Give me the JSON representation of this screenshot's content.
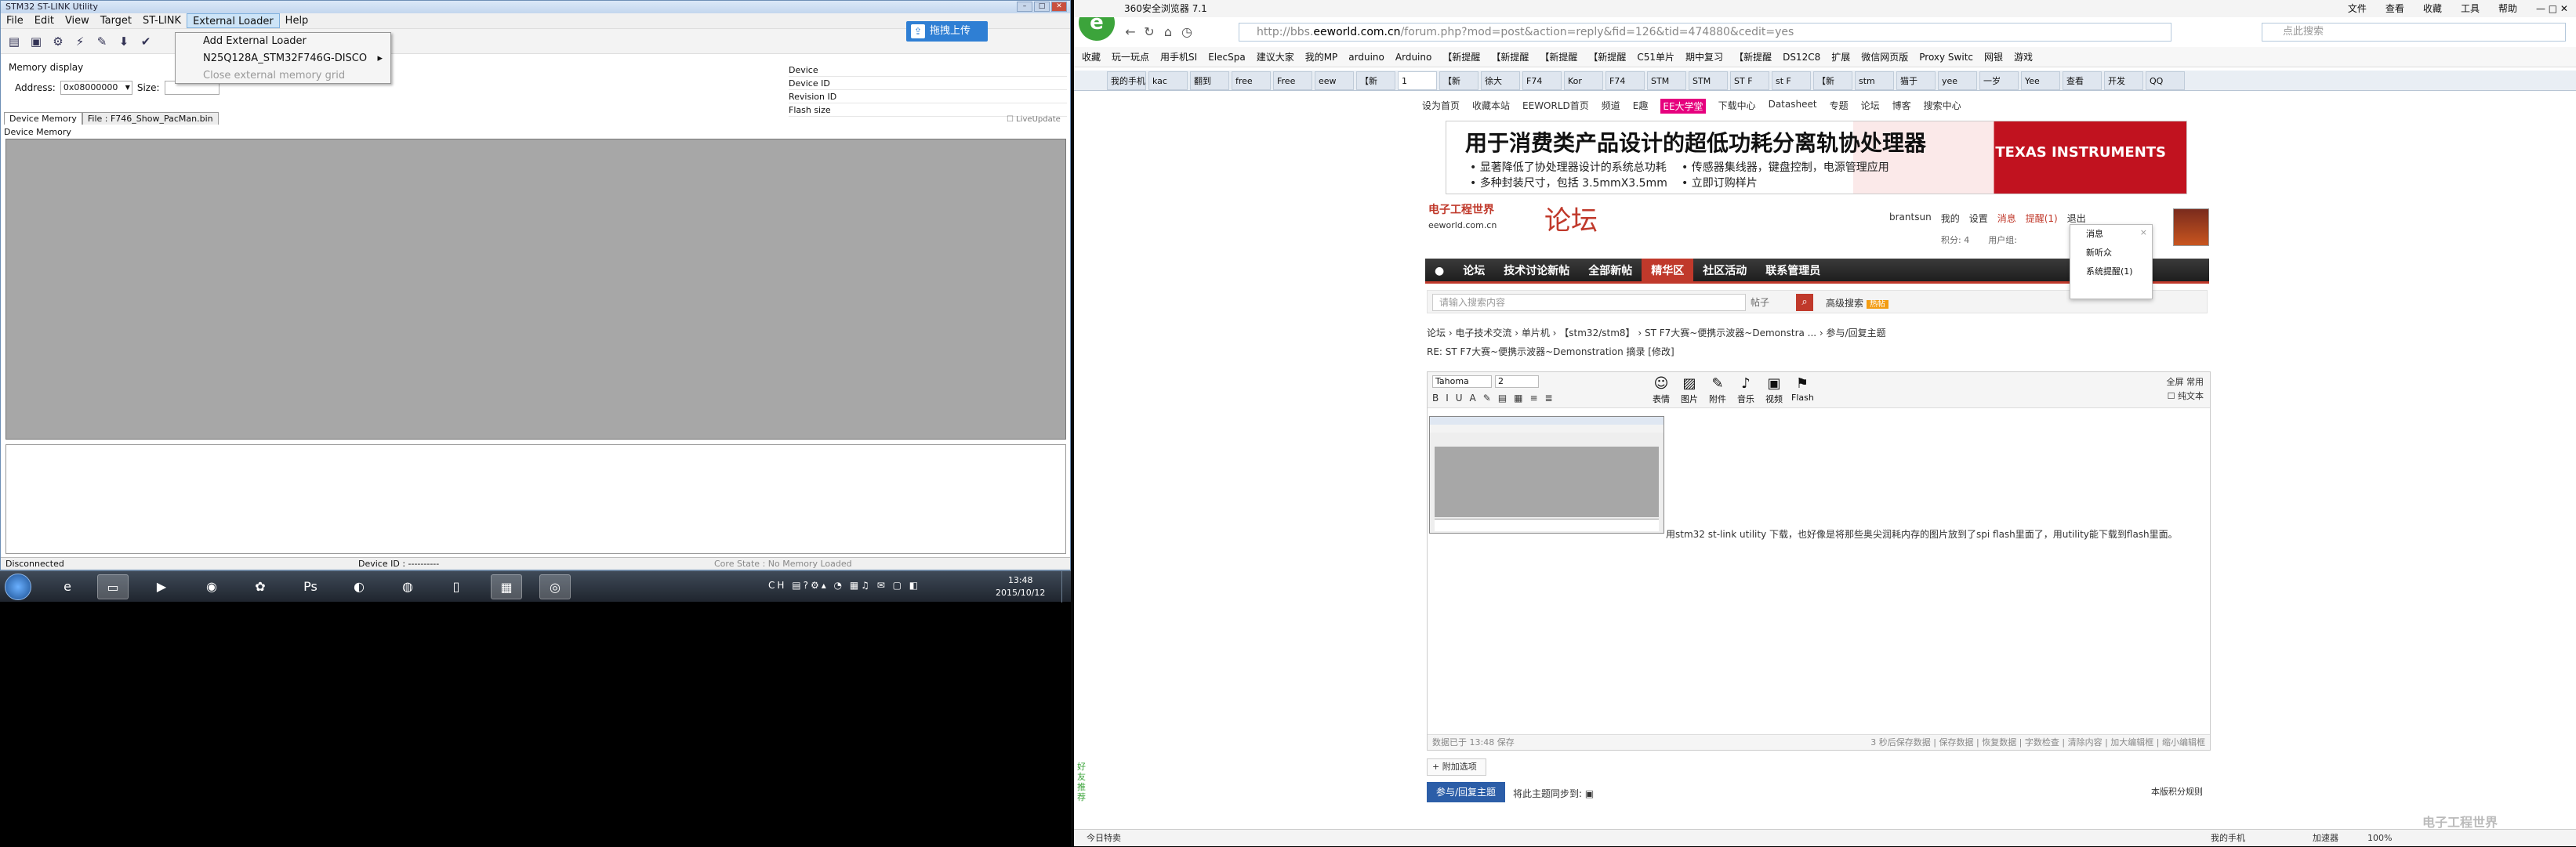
{
  "stlink": {
    "title": "STM32 ST-LINK Utility",
    "menu": [
      "File",
      "Edit",
      "View",
      "Target",
      "ST-LINK",
      "External Loader",
      "Help"
    ],
    "connect_label": "拖拽上传",
    "dropdown": {
      "item1": "Add External Loader",
      "item2": "N25Q128A_STM32F746G-DISCO",
      "item3": "Close external memory grid"
    },
    "memory_display_label": "Memory display",
    "address_label": "Address:",
    "address_value": "0x08000000",
    "size_label": "Size:",
    "device_info": [
      "Device",
      "Device ID",
      "Revision ID",
      "Flash size"
    ],
    "tabs": [
      "Device Memory",
      "File : F746_Show_PacMan.bin"
    ],
    "live_update": "LiveUpdate",
    "device_memory_label": "Device Memory",
    "status": {
      "connection": "Disconnected",
      "device_id": "Device ID : ----------",
      "core_state": "Core State : No Memory Loaded"
    }
  },
  "taskbar": {
    "time": "13:48",
    "date": "2015/10/12",
    "tray_lang": "CH"
  },
  "browser": {
    "title": "360安全浏览器 7.1",
    "menu": [
      "文件",
      "查看",
      "收藏",
      "工具",
      "帮助"
    ],
    "url_prefix": "http://bbs.",
    "url_host": "eeworld.com.cn",
    "url_rest": "/forum.php?mod=post&action=reply&fid=126&tid=474880&cedit=yes",
    "search_placeholder": "点此搜索",
    "bookmarks": [
      "收藏",
      "玩一玩点",
      "用手机SI",
      "ElecSpa",
      "建议大家",
      "我的MP",
      "arduino",
      "Arduino",
      "【新提醒",
      "【新提醒",
      "【新提醒",
      "【新提醒",
      "C51单片",
      "期中复习",
      "【新提醒",
      "DS12C8",
      "扩展",
      "微信网页版",
      "Proxy Switc",
      "网银",
      "游戏"
    ],
    "tabs": [
      "我的手机",
      "kac",
      "翻到",
      "free",
      "Free",
      "eew",
      "【新",
      "1",
      "【新",
      "徐大",
      "F74",
      "Kor",
      "F74",
      "STM",
      "STM",
      "ST F",
      "st F",
      "【新",
      "stm",
      "猫于",
      "yee",
      "一岁",
      "Yee",
      "查看",
      "开发",
      "QQ"
    ]
  },
  "forum": {
    "topbar": [
      "设为首页",
      "收藏本站",
      "EEWORLD首页",
      "频道",
      "E趣",
      "EE大学堂",
      "下载中心",
      "Datasheet",
      "专题",
      "论坛",
      "博客",
      "搜索中心"
    ],
    "banner": {
      "title": "用于消费类产品设计的超低功耗分离轨协处理器",
      "line1": "• 显著降低了协处理器设计的系统总功耗",
      "line2": "• 多种封装尺寸，包括 3.5mmX3.5mm",
      "line3": "• 传感器集线器，键盘控制，电源管理应用",
      "line4": "• 立即订购样片",
      "brand": "TEXAS INSTRUMENTS"
    },
    "logo_title": "电子工程世界",
    "logo_sub": "eeworld.com.cn",
    "section_name": "论坛",
    "user": {
      "name": "brantsun",
      "items": [
        "我的",
        "设置",
        "消息",
        "提醒(1)",
        "退出"
      ],
      "credit": "积分: 4",
      "group": "用户组:"
    },
    "notif": [
      "消息",
      "新听众",
      "系统提醒(1)"
    ],
    "nav": [
      "论坛",
      "技术讨论新帖",
      "全部新帖",
      "精华区",
      "社区活动",
      "联系管理员"
    ],
    "search": {
      "placeholder": "请输入搜索内容",
      "scope": "帖子",
      "hot": "高级搜索",
      "badge": "热帖"
    },
    "breadcrumb": "论坛 › 电子技术交流 › 单片机 › 【stm32/stm8】 › ST F7大赛~便携示波器~Demonstra ... › 参与/回复主题",
    "post_title": "RE: ST F7大赛~便携示波器~Demonstration 摘录 [修改]",
    "editor": {
      "font": "Tahoma",
      "size": "2",
      "big_buttons": [
        "表情",
        "图片",
        "附件",
        "音乐",
        "视频",
        "Flash"
      ],
      "fullscreen": "全屏",
      "common": "常用",
      "plaintext": "纯文本",
      "content": "用stm32 st-link utility 下载，也好像是将那些奥尖润耗内存的图片放到了spi flash里面了，用utility能下载到flash里面。",
      "status_left": "数据已于 13:48 保存",
      "status_right": "3 秒后保存数据 | 保存数据 | 恢复数据 | 字数检查 | 清除内容 | 加大编辑框 | 缩小编辑框"
    },
    "attach_option": "+ 附加选项",
    "submit": "参与/回复主题",
    "submit_hint": "将此主题同步到:",
    "rules": "本版积分规则",
    "side_btn": "好友推荐"
  },
  "browser_status": {
    "left": "今日特卖",
    "phone": "我的手机",
    "accel": "加速器",
    "zoom": "100%"
  },
  "watermark": "电子工程世界"
}
